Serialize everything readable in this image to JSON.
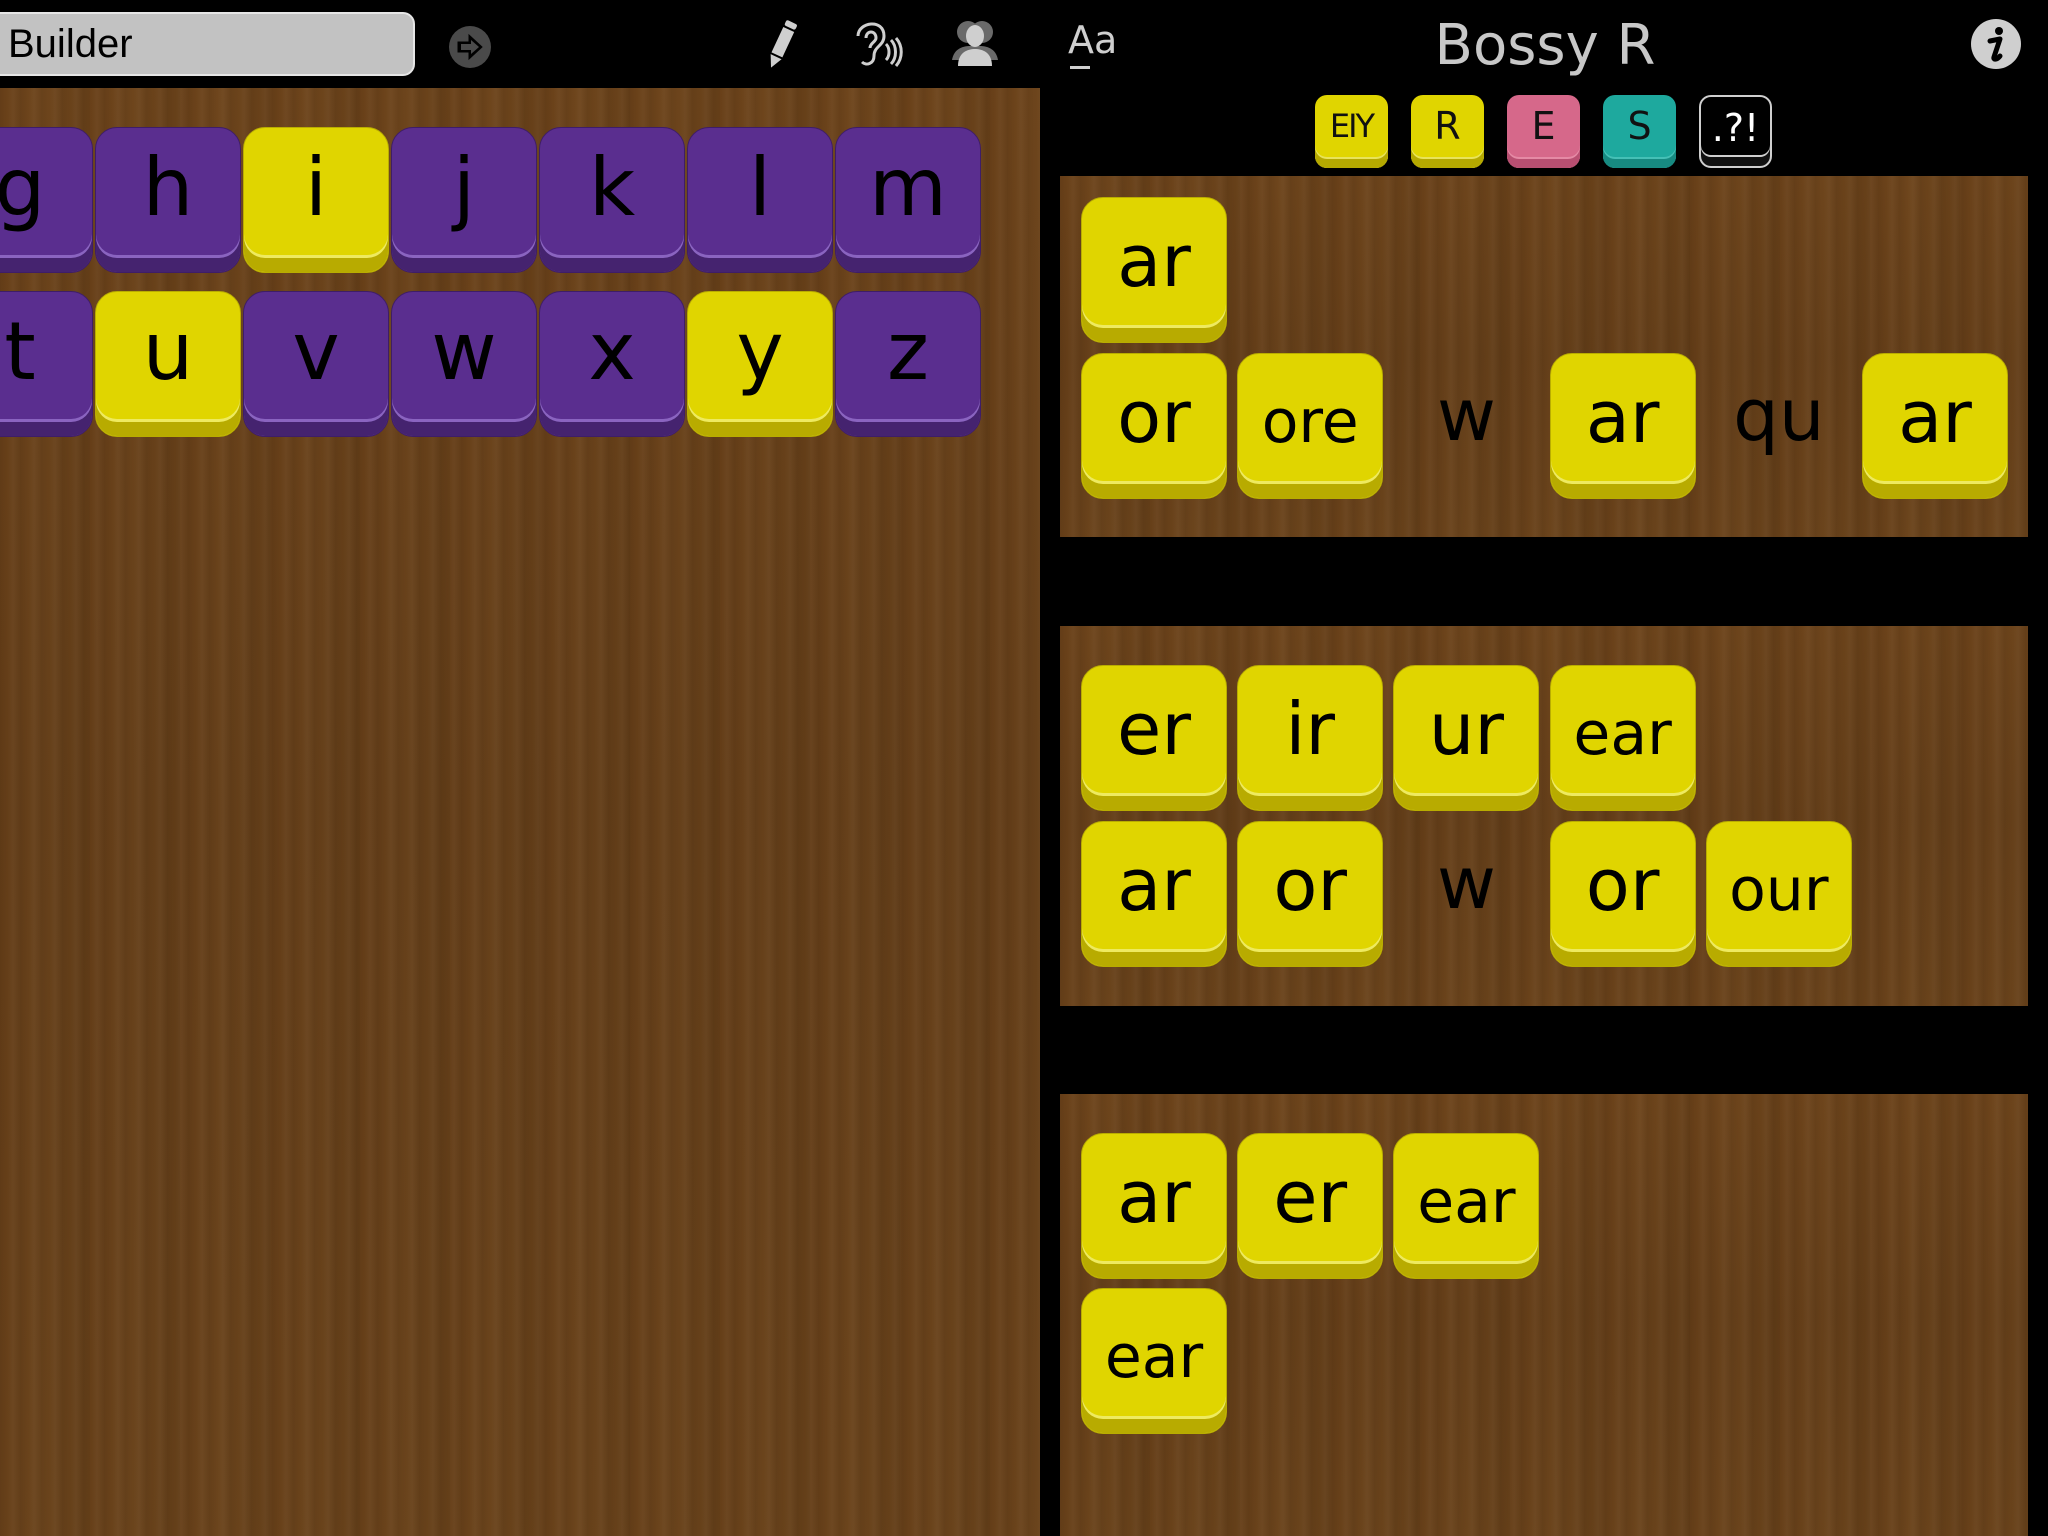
{
  "topbar": {
    "builder_value": "Builder",
    "title": "Bossy R",
    "font_toggle_label": "Aa",
    "icons": [
      "go-arrow-icon",
      "pencil-icon",
      "ear-sound-icon",
      "users-icon",
      "font-icon",
      "info-icon"
    ]
  },
  "categories": [
    {
      "label": "EIY",
      "color": "#e0d500"
    },
    {
      "label": "R",
      "color": "#e0d500"
    },
    {
      "label": "E",
      "color": "#d6688a"
    },
    {
      "label": "S",
      "color": "#1ea99e"
    },
    {
      ".label": null,
      "label": ".?!",
      "color": "#000000"
    }
  ],
  "colors": {
    "consonant_tile": "#5a2e8f",
    "vowel_tile": "#e0d500",
    "wood": "#6a421a"
  },
  "letter_rows": [
    [
      {
        "letter": "g",
        "vowel": false
      },
      {
        "letter": "h",
        "vowel": false
      },
      {
        "letter": "i",
        "vowel": true
      },
      {
        "letter": "j",
        "vowel": false
      },
      {
        "letter": "k",
        "vowel": false
      },
      {
        "letter": "l",
        "vowel": false
      },
      {
        "letter": "m",
        "vowel": false
      }
    ],
    [
      {
        "letter": "t",
        "vowel": false
      },
      {
        "letter": "u",
        "vowel": true
      },
      {
        "letter": "v",
        "vowel": false
      },
      {
        "letter": "w",
        "vowel": false
      },
      {
        "letter": "x",
        "vowel": false
      },
      {
        "letter": "y",
        "vowel": true
      },
      {
        "letter": "z",
        "vowel": false
      }
    ]
  ],
  "panels": [
    {
      "rows": [
        [
          {
            "text": "ar",
            "tile": true
          }
        ],
        [
          {
            "text": "or",
            "tile": true
          },
          {
            "text": "ore",
            "tile": true
          },
          {
            "text": "w",
            "tile": false
          },
          {
            "text": "ar",
            "tile": true
          },
          {
            "text": "qu",
            "tile": false
          },
          {
            "text": "ar",
            "tile": true
          }
        ]
      ]
    },
    {
      "rows": [
        [
          {
            "text": "er",
            "tile": true
          },
          {
            "text": "ir",
            "tile": true
          },
          {
            "text": "ur",
            "tile": true
          },
          {
            "text": "ear",
            "tile": true
          }
        ],
        [
          {
            "text": "ar",
            "tile": true
          },
          {
            "text": "or",
            "tile": true
          },
          {
            "text": "w",
            "tile": false
          },
          {
            "text": "or",
            "tile": true
          },
          {
            "text": "our",
            "tile": true
          }
        ]
      ]
    },
    {
      "rows": [
        [
          {
            "text": "ar",
            "tile": true
          },
          {
            "text": "er",
            "tile": true
          },
          {
            "text": "ear",
            "tile": true
          }
        ],
        [
          {
            "text": "ear",
            "tile": true
          }
        ]
      ]
    }
  ]
}
